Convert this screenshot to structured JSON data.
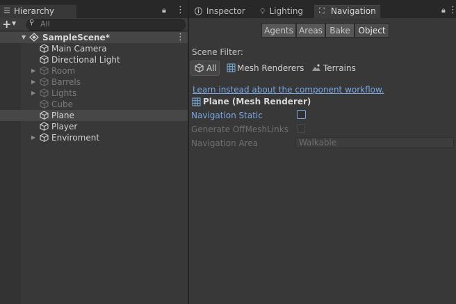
{
  "hierarchy": {
    "tab_label": "Hierarchy",
    "search_placeholder": "All",
    "scene_name": "SampleScene*",
    "items": [
      {
        "label": "Main Camera",
        "enabled": true,
        "foldout": false
      },
      {
        "label": "Directional Light",
        "enabled": true,
        "foldout": false
      },
      {
        "label": "Room",
        "enabled": false,
        "foldout": true
      },
      {
        "label": "Barrels",
        "enabled": false,
        "foldout": true
      },
      {
        "label": "Lights",
        "enabled": false,
        "foldout": true
      },
      {
        "label": "Cube",
        "enabled": false,
        "foldout": false
      },
      {
        "label": "Plane",
        "enabled": true,
        "foldout": false,
        "selected": true
      },
      {
        "label": "Player",
        "enabled": true,
        "foldout": false
      },
      {
        "label": "Enviroment",
        "enabled": true,
        "foldout": true
      }
    ]
  },
  "right_tabs": {
    "inspector": "Inspector",
    "lighting": "Lighting",
    "navigation": "Navigation"
  },
  "nav_sections": [
    "Agents",
    "Areas",
    "Bake",
    "Object"
  ],
  "active_section": "Object",
  "scene_filter": {
    "label": "Scene Filter:",
    "options": [
      "All",
      "Mesh Renderers",
      "Terrains"
    ]
  },
  "object": {
    "link": "Learn instead about the component workflow.",
    "selection_title": "Plane (Mesh Renderer)",
    "navigation_static_label": "Navigation Static",
    "offmesh_label": "Generate OffMeshLinks",
    "area_label": "Navigation Area",
    "area_value": "Walkable"
  },
  "colors": {
    "link": "#7aa7e6",
    "selected_row": "#474747"
  }
}
